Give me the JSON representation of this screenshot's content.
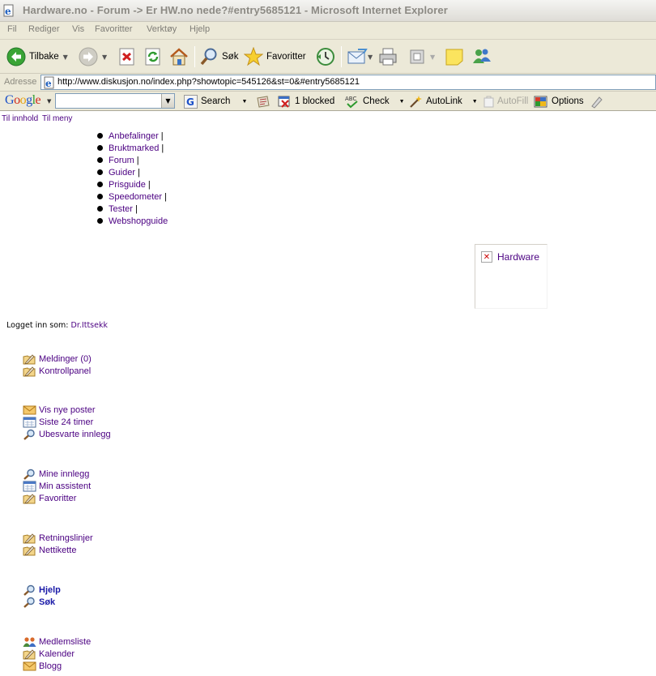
{
  "window": {
    "title": "Hardware.no - Forum -> Er HW.no nede?#entry5685121 - Microsoft Internet Explorer"
  },
  "menubar": [
    "Fil",
    "Rediger",
    "Vis",
    "Favoritter",
    "Verktøy",
    "Hjelp"
  ],
  "toolbar": {
    "back_label": "Tilbake",
    "search_label": "Søk",
    "favorites_label": "Favoritter"
  },
  "addressbar": {
    "label": "Adresse",
    "url": "http://www.diskusjon.no/index.php?showtopic=545126&st=0&#entry5685121"
  },
  "googlebar": {
    "logo": "Google",
    "search_label": "Search",
    "blocked_label": "1 blocked",
    "check_label": "Check",
    "autolink_label": "AutoLink",
    "autofill_label": "AutoFill",
    "options_label": "Options"
  },
  "page": {
    "skip_content": "Til innhold",
    "skip_menu": "Til meny",
    "nav": [
      "Anbefalinger",
      "Bruktmarked",
      "Forum",
      "Guider",
      "Prisguide",
      "Speedometer",
      "Tester",
      "Webshopguide"
    ],
    "nav_separator": "|",
    "logo_alt": "Hardware",
    "logged_in_prefix": "Logget inn som:",
    "logged_in_user": "Dr.Ittsekk",
    "groups": [
      [
        {
          "label": "Meldinger (0)",
          "icon": "folder-pencil-icon"
        },
        {
          "label": "Kontrollpanel",
          "icon": "folder-pencil-icon"
        }
      ],
      [
        {
          "label": "Vis nye poster",
          "icon": "envelope-icon"
        },
        {
          "label": "Siste 24 timer",
          "icon": "calendar-icon"
        },
        {
          "label": "Ubesvarte innlegg",
          "icon": "magnifier-icon"
        }
      ],
      [
        {
          "label": "Mine innlegg",
          "icon": "magnifier-icon"
        },
        {
          "label": "Min assistent",
          "icon": "calendar-icon"
        },
        {
          "label": "Favoritter",
          "icon": "folder-pencil-icon"
        }
      ],
      [
        {
          "label": "Retningslinjer",
          "icon": "folder-pencil-icon"
        },
        {
          "label": "Nettikette",
          "icon": "folder-pencil-icon"
        }
      ],
      [
        {
          "label": "Hjelp",
          "icon": "magnifier-icon"
        },
        {
          "label": "Søk",
          "icon": "magnifier-icon"
        }
      ],
      [
        {
          "label": "Medlemsliste",
          "icon": "users-icon"
        },
        {
          "label": "Kalender",
          "icon": "folder-pencil-icon"
        },
        {
          "label": "Blogg",
          "icon": "envelope-icon"
        }
      ]
    ]
  }
}
